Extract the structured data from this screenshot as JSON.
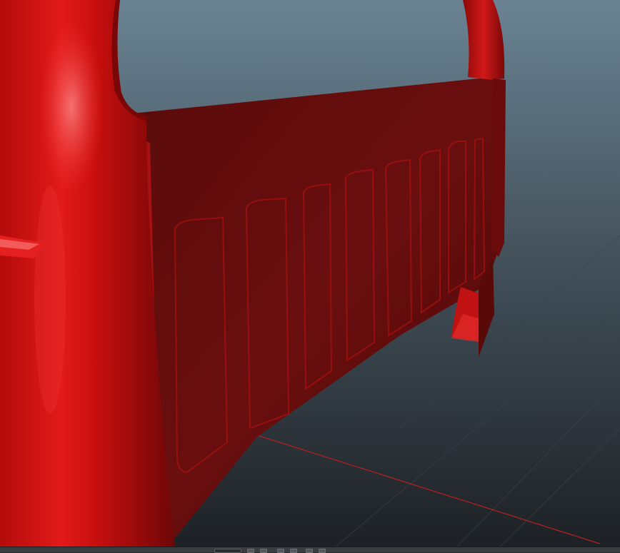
{
  "viewport": {
    "background_top_color": "#667f90",
    "background_bottom_color": "#1e2226",
    "object_color": "#c00a0a",
    "object_shadow_color": "#5a0c0c",
    "grid_axis_color": "#b02020"
  },
  "timebar": {
    "frame_value": "",
    "playback_buttons": [
      {
        "icon": "go-to-start-icon"
      },
      {
        "icon": "step-back-icon"
      },
      {
        "icon": "play-backward-icon"
      },
      {
        "icon": "play-forward-icon"
      },
      {
        "icon": "step-forward-icon"
      },
      {
        "icon": "go-to-end-icon"
      }
    ]
  }
}
